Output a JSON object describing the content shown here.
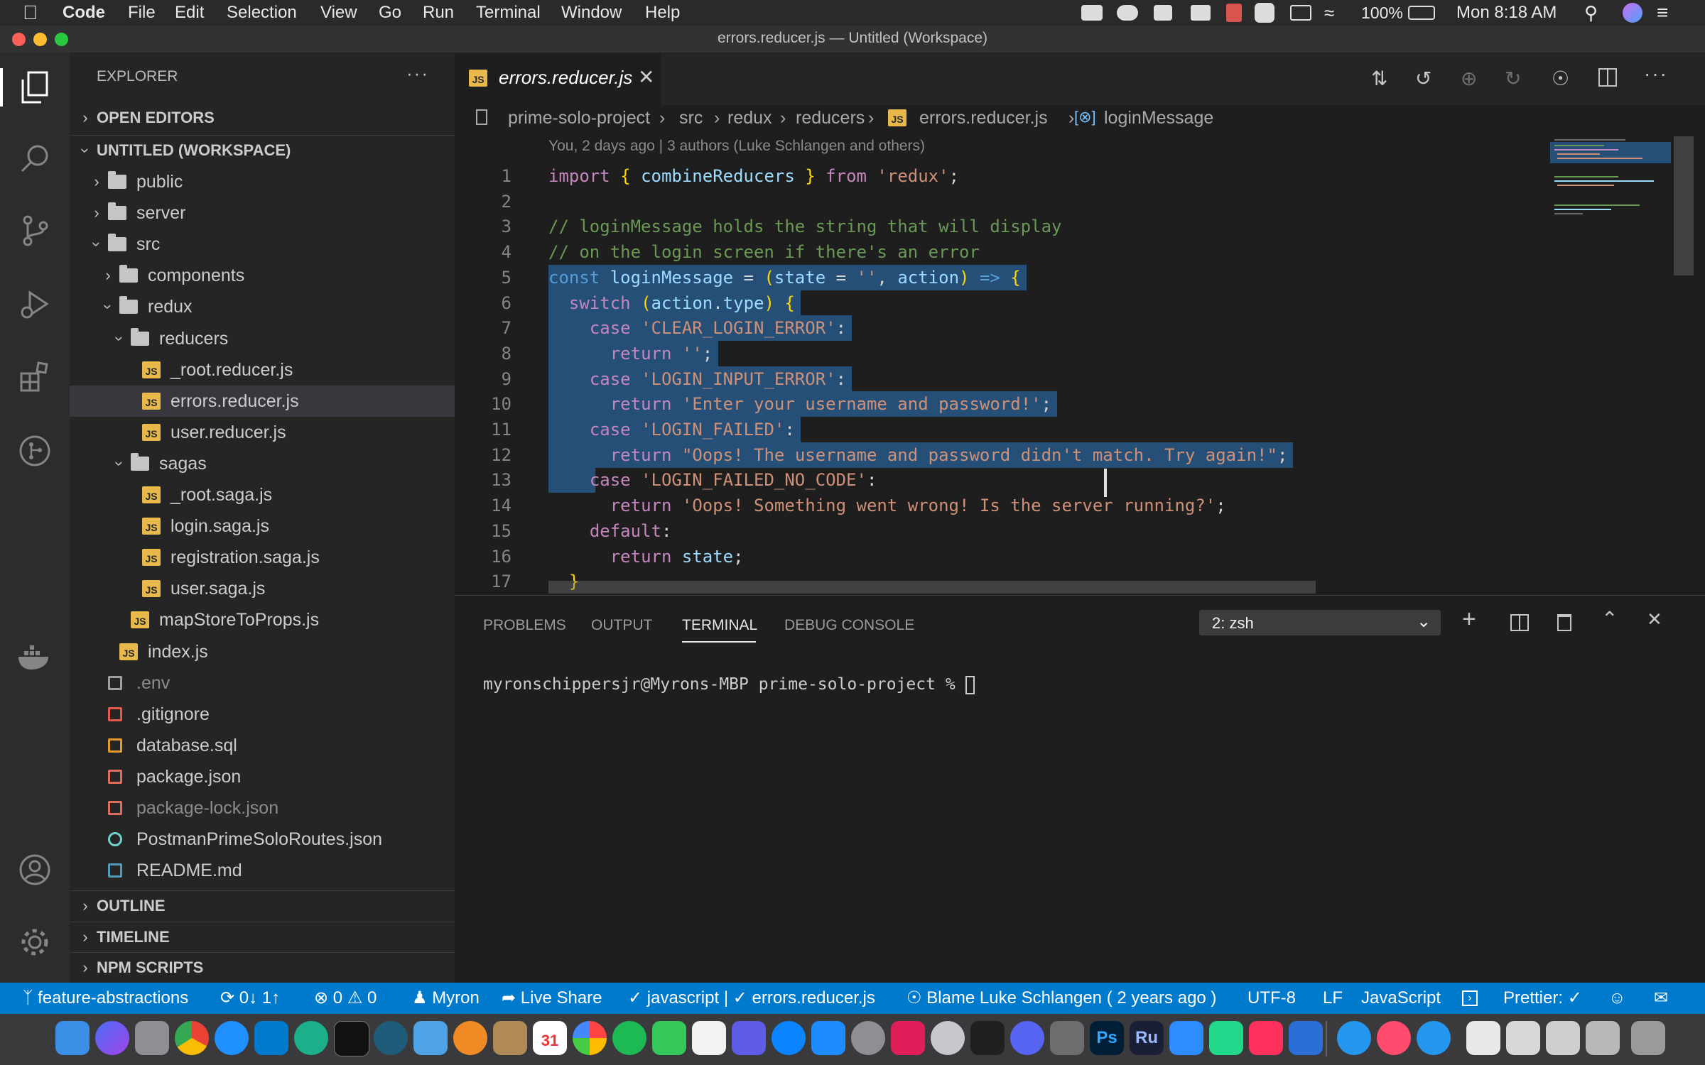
{
  "menubar": {
    "app_name": "Code",
    "items": [
      "File",
      "Edit",
      "Selection",
      "View",
      "Go",
      "Run",
      "Terminal",
      "Window",
      "Help"
    ],
    "battery": "100%",
    "clock": "Mon 8:18 AM"
  },
  "window": {
    "title": "errors.reducer.js — Untitled (Workspace)"
  },
  "activity_bar": {
    "icons": [
      "explorer-icon",
      "search-icon",
      "source-control-icon",
      "run-debug-icon",
      "extensions-icon",
      "git-graph-icon",
      "docker-icon",
      "account-icon",
      "settings-gear-icon"
    ]
  },
  "sidebar": {
    "title": "EXPLORER",
    "sections": {
      "open_editors": "OPEN EDITORS",
      "workspace": "UNTITLED (WORKSPACE)",
      "outline": "OUTLINE",
      "timeline": "TIMELINE",
      "npm_scripts": "NPM SCRIPTS"
    },
    "tree": [
      {
        "label": "public",
        "kind": "folder",
        "expanded": false,
        "depth": 1
      },
      {
        "label": "server",
        "kind": "folder",
        "expanded": false,
        "depth": 1
      },
      {
        "label": "src",
        "kind": "folder",
        "expanded": true,
        "depth": 1
      },
      {
        "label": "components",
        "kind": "folder",
        "expanded": false,
        "depth": 2
      },
      {
        "label": "redux",
        "kind": "folder",
        "expanded": true,
        "depth": 2
      },
      {
        "label": "reducers",
        "kind": "folder",
        "expanded": true,
        "depth": 3
      },
      {
        "label": "_root.reducer.js",
        "kind": "js",
        "depth": 4
      },
      {
        "label": "errors.reducer.js",
        "kind": "js",
        "depth": 4,
        "selected": true
      },
      {
        "label": "user.reducer.js",
        "kind": "js",
        "depth": 4
      },
      {
        "label": "sagas",
        "kind": "folder",
        "expanded": true,
        "depth": 3
      },
      {
        "label": "_root.saga.js",
        "kind": "js",
        "depth": 4
      },
      {
        "label": "login.saga.js",
        "kind": "js",
        "depth": 4
      },
      {
        "label": "registration.saga.js",
        "kind": "js",
        "depth": 4
      },
      {
        "label": "user.saga.js",
        "kind": "js",
        "depth": 4
      },
      {
        "label": "mapStoreToProps.js",
        "kind": "js",
        "depth": 3
      },
      {
        "label": "index.js",
        "kind": "js",
        "depth": 2
      },
      {
        "label": ".env",
        "kind": "env",
        "depth": 1
      },
      {
        "label": ".gitignore",
        "kind": "git",
        "depth": 1
      },
      {
        "label": "database.sql",
        "kind": "db",
        "depth": 1
      },
      {
        "label": "package.json",
        "kind": "pkg",
        "depth": 1
      },
      {
        "label": "package-lock.json",
        "kind": "pkg-dim",
        "depth": 1
      },
      {
        "label": "PostmanPrimeSoloRoutes.json",
        "kind": "postman",
        "depth": 1
      },
      {
        "label": "README.md",
        "kind": "md",
        "depth": 1
      }
    ]
  },
  "tabs": [
    {
      "label": "errors.reducer.js",
      "active": true
    }
  ],
  "breadcrumb": [
    "prime-solo-project",
    "src",
    "redux",
    "reducers",
    "errors.reducer.js",
    "loginMessage"
  ],
  "editor": {
    "blame_hint": "You, 2 days ago | 3 authors (Luke Schlangen and others)",
    "lines": [
      {
        "n": "1",
        "text": "import { combineReducers } from 'redux';"
      },
      {
        "n": "2",
        "text": ""
      },
      {
        "n": "3",
        "text": "// loginMessage holds the string that will display"
      },
      {
        "n": "4",
        "text": "// on the login screen if there's an error"
      },
      {
        "n": "5",
        "text": "const loginMessage = (state = '', action) => {"
      },
      {
        "n": "6",
        "text": "  switch (action.type) {"
      },
      {
        "n": "7",
        "text": "    case 'CLEAR_LOGIN_ERROR':"
      },
      {
        "n": "8",
        "text": "      return '';"
      },
      {
        "n": "9",
        "text": "    case 'LOGIN_INPUT_ERROR':"
      },
      {
        "n": "10",
        "text": "      return 'Enter your username and password!';"
      },
      {
        "n": "11",
        "text": "    case 'LOGIN_FAILED':"
      },
      {
        "n": "12",
        "text": "      return \"Oops! The username and password didn't match. Try again!\";"
      },
      {
        "n": "13",
        "text": "    case 'LOGIN_FAILED_NO_CODE':"
      },
      {
        "n": "14",
        "text": "      return 'Oops! Something went wrong! Is the server running?';"
      },
      {
        "n": "15",
        "text": "    default:"
      },
      {
        "n": "16",
        "text": "      return state;"
      },
      {
        "n": "17",
        "text": "  }"
      }
    ]
  },
  "panel": {
    "tabs": [
      "PROBLEMS",
      "OUTPUT",
      "TERMINAL",
      "DEBUG CONSOLE"
    ],
    "active_tab": "TERMINAL",
    "terminal_select": "2: zsh",
    "prompt": "myronschippersjr@Myrons-MBP prime-solo-project % "
  },
  "statusbar": {
    "branch": "feature-abstractions",
    "sync": "0↓ 1↑",
    "errors": "0",
    "warnings": "0",
    "user": "Myron",
    "live_share": "Live Share",
    "lint": "javascript | ✓ errors.reducer.js",
    "blame": "Blame Luke Schlangen ( 2 years ago )",
    "encoding": "UTF-8",
    "eol": "LF",
    "language": "JavaScript",
    "prettier": "Prettier: ✓"
  },
  "dock": {
    "calendar_day": "31"
  },
  "colors": {
    "accent": "#007acc",
    "selection": "#264f78",
    "keyword": "#c586c0",
    "string": "#ce9178",
    "comment": "#6a9955",
    "variable": "#9cdcfe",
    "function": "#dcdcaa"
  }
}
